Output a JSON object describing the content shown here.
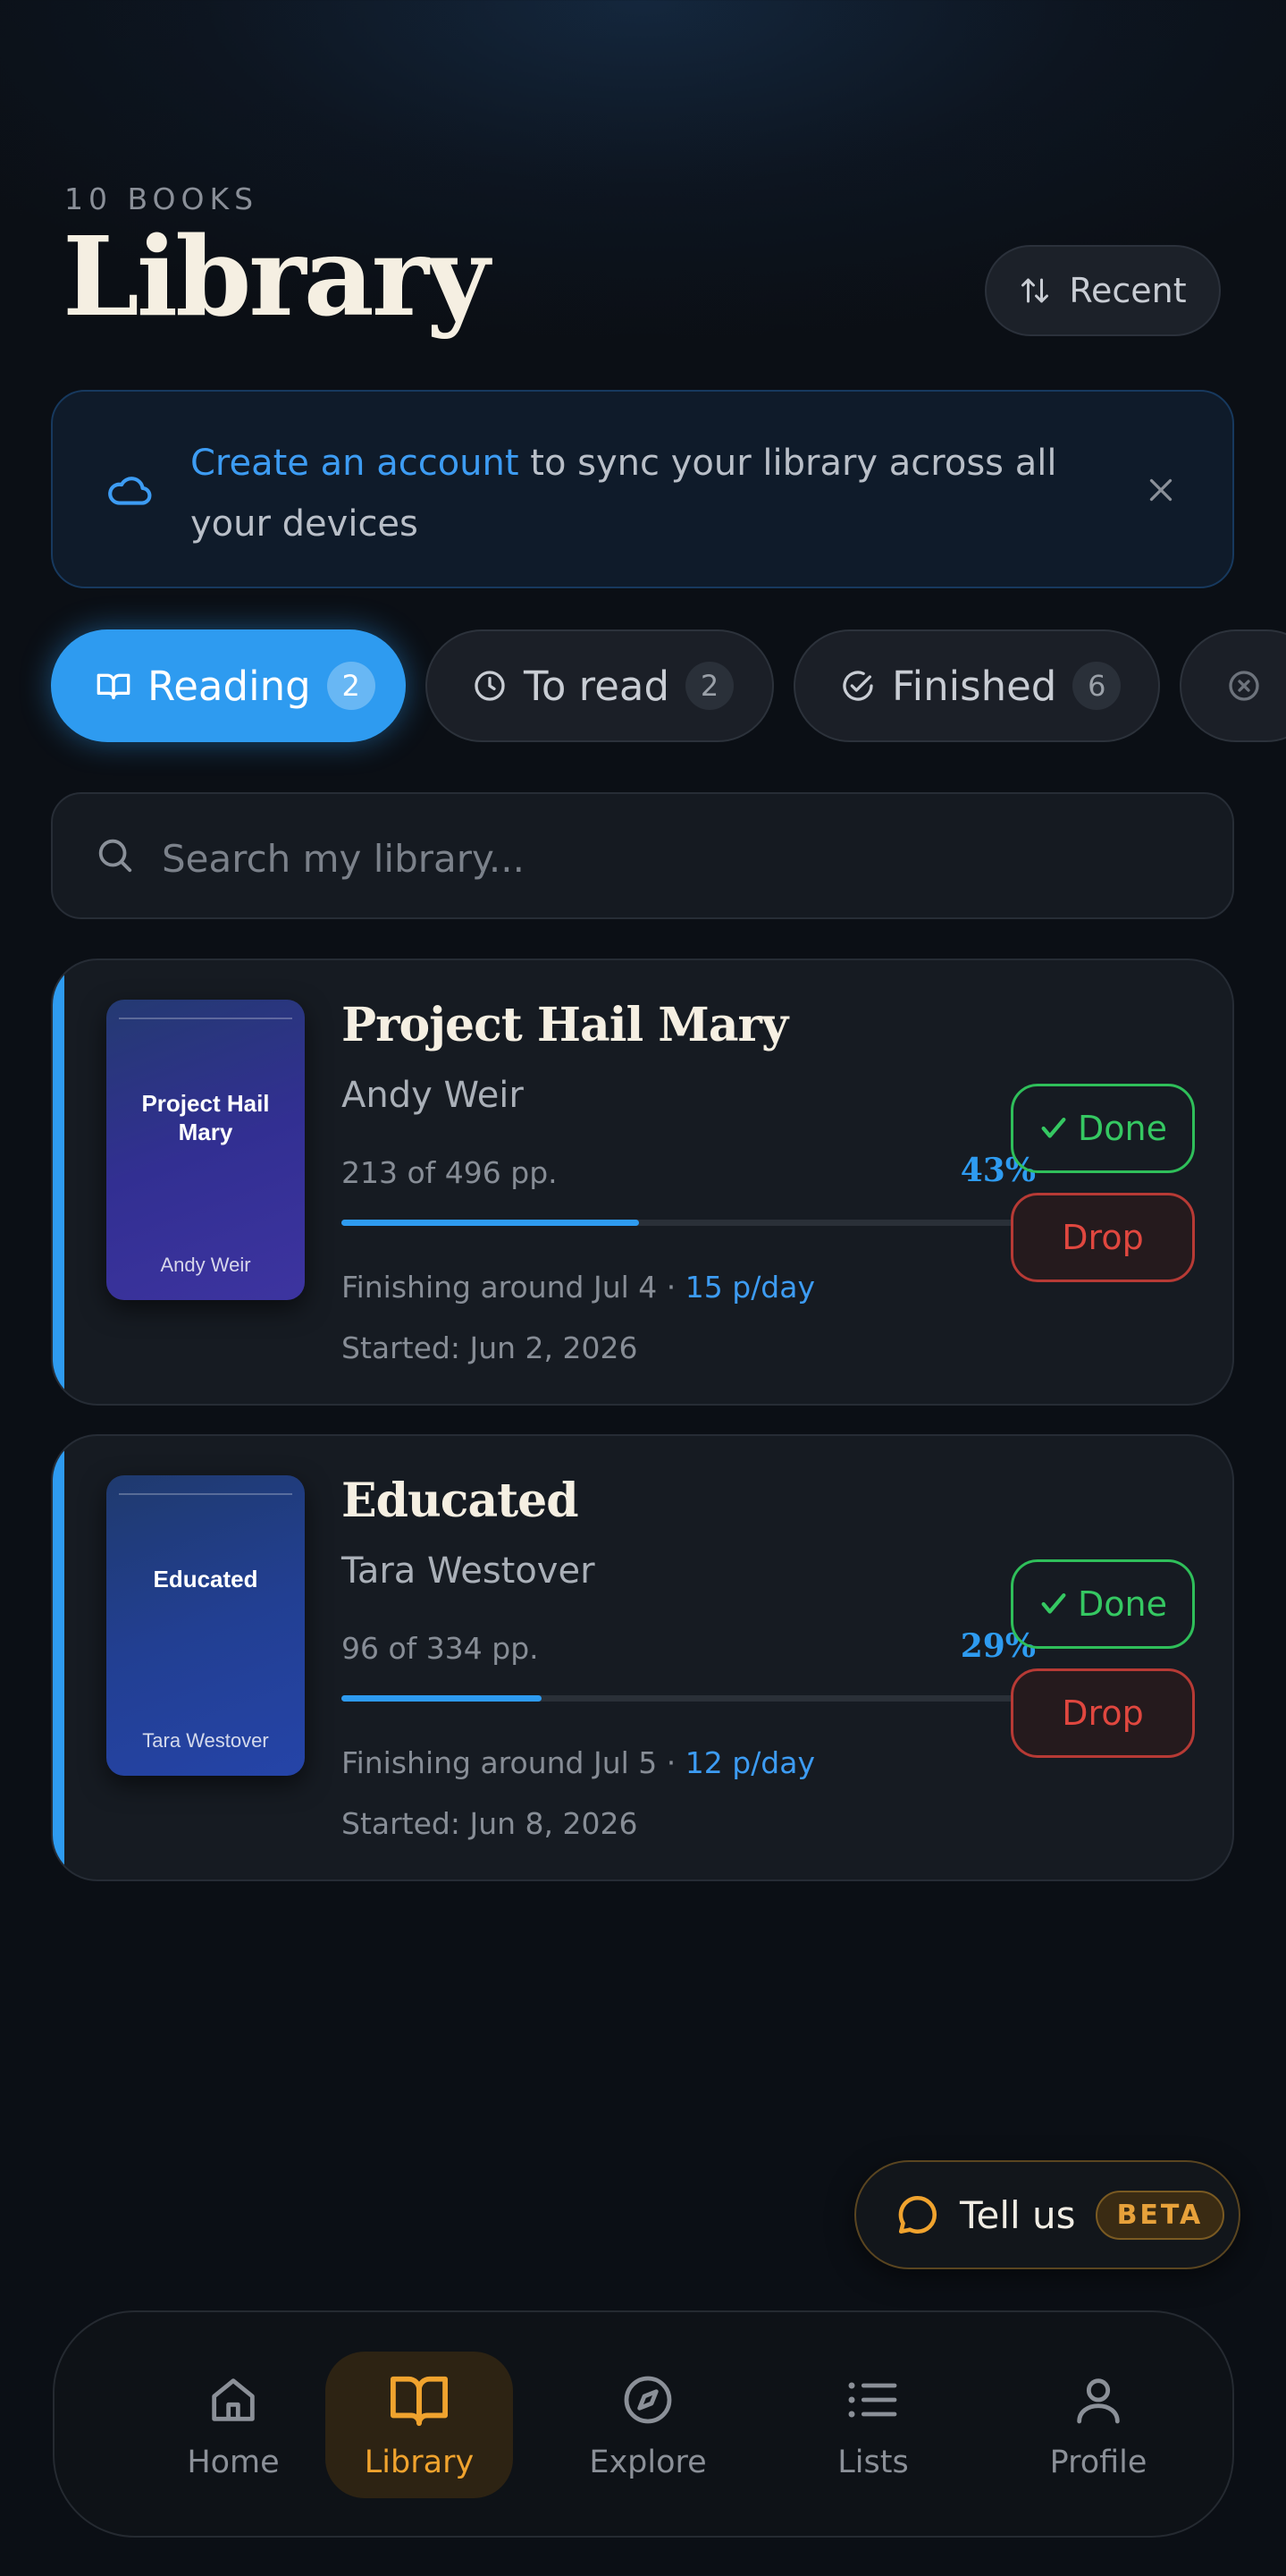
{
  "header": {
    "count_label": "10 BOOKS",
    "title": "Library",
    "sort_label": "Recent"
  },
  "banner": {
    "link_text": "Create an account",
    "message": " to sync your library across all your devices"
  },
  "tabs": [
    {
      "label": "Reading",
      "count": "2",
      "icon": "open-book-icon",
      "active": true
    },
    {
      "label": "To read",
      "count": "2",
      "icon": "clock-icon",
      "active": false
    },
    {
      "label": "Finished",
      "count": "6",
      "icon": "check-circle-icon",
      "active": false
    },
    {
      "label": "",
      "count": "",
      "icon": "x-circle-icon",
      "active": false
    }
  ],
  "search": {
    "placeholder": "Search my library..."
  },
  "books": [
    {
      "title": "Project Hail Mary",
      "author": "Andy Weir",
      "pages": "213 of 496 pp.",
      "percent": "43%",
      "progress": 0.43,
      "finishing": "Finishing around Jul 4 · ",
      "rate": "15 p/day",
      "started": "Started: Jun 2, 2026",
      "cover_title": "Project Hail Mary",
      "cover_author": "Andy Weir",
      "cover_colors": [
        "#243a72",
        "#322f92",
        "#3d34a0"
      ],
      "done_label": "Done",
      "drop_label": "Drop"
    },
    {
      "title": "Educated",
      "author": "Tara Westover",
      "pages": "96 of 334 pp.",
      "percent": "29%",
      "progress": 0.29,
      "finishing": "Finishing around Jul 5 · ",
      "rate": "12 p/day",
      "started": "Started: Jun 8, 2026",
      "cover_title": "Educated",
      "cover_author": "Tara Westover",
      "cover_colors": [
        "#1f3a6e",
        "#223f92",
        "#2544a8"
      ],
      "done_label": "Done",
      "drop_label": "Drop"
    }
  ],
  "feedback": {
    "label": "Tell us",
    "badge": "BETA"
  },
  "nav": [
    {
      "label": "Home",
      "icon": "home-icon"
    },
    {
      "label": "Library",
      "icon": "book-icon"
    },
    {
      "label": "Explore",
      "icon": "compass-icon"
    },
    {
      "label": "Lists",
      "icon": "list-icon"
    },
    {
      "label": "Profile",
      "icon": "user-icon"
    }
  ],
  "colors": {
    "accent": "#2e9bf0",
    "done": "#35c862",
    "drop": "#e0473f",
    "nav_active": "#f0a32e"
  }
}
